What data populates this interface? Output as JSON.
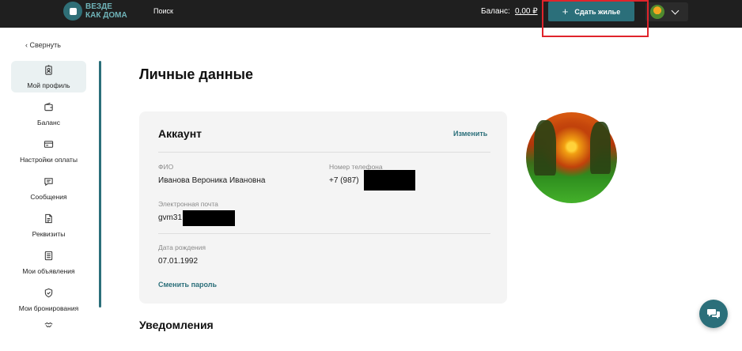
{
  "header": {
    "logo_line1": "ВЕЗДЕ",
    "logo_line2": "КАК ДОМА",
    "nav_search": "Поиск",
    "balance_label": "Баланс:",
    "balance_value": "0,00 ₽",
    "cta_label": "Сдать жилье",
    "cta_icon": "plus-icon"
  },
  "sidebar": {
    "collapse_label": "‹ Свернуть",
    "items": [
      {
        "label": "Мой профиль",
        "icon": "profile-badge-icon",
        "active": true
      },
      {
        "label": "Баланс",
        "icon": "wallet-icon"
      },
      {
        "label": "Настройки оплаты",
        "icon": "card-icon"
      },
      {
        "label": "Сообщения",
        "icon": "message-icon"
      },
      {
        "label": "Реквизиты",
        "icon": "document-icon"
      },
      {
        "label": "Мои объявления",
        "icon": "list-icon"
      },
      {
        "label": "Мои бронирования",
        "icon": "shield-check-icon"
      },
      {
        "label": "",
        "icon": "handshake-icon"
      }
    ]
  },
  "main": {
    "page_title": "Личные данные",
    "account": {
      "title": "Аккаунт",
      "edit_label": "Изменить",
      "fio_label": "ФИО",
      "fio_value": "Иванова Вероника Ивановна",
      "phone_label": "Номер телефона",
      "phone_value": "+7 (987)",
      "email_label": "Электронная почта",
      "email_value": "gvm31",
      "birth_label": "Дата рождения",
      "birth_value": "07.01.1992",
      "change_password": "Сменить пароль"
    },
    "notifications_title": "Уведомления"
  },
  "colors": {
    "accent": "#2b6f7a",
    "header_bg": "#1f1f1f",
    "highlight_border": "#e0242b",
    "card_bg": "#f4f4f4"
  }
}
